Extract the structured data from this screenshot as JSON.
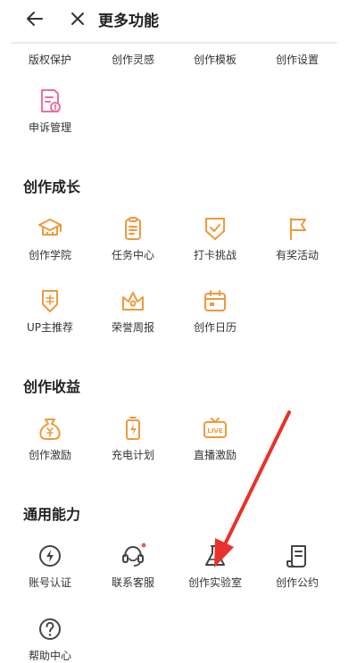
{
  "header": {
    "title": "更多功能"
  },
  "top_row": [
    "版权保护",
    "创作灵感",
    "创作模板",
    "创作设置"
  ],
  "top_extra": {
    "label": "申诉管理"
  },
  "sections": [
    {
      "title": "创作成长",
      "items": [
        "创作学院",
        "任务中心",
        "打卡挑战",
        "有奖活动",
        "UP主推荐",
        "荣誉周报",
        "创作日历"
      ]
    },
    {
      "title": "创作收益",
      "items": [
        "创作激励",
        "充电计划",
        "直播激励"
      ]
    },
    {
      "title": "通用能力",
      "items": [
        "账号认证",
        "联系客服",
        "创作实验室",
        "创作公约",
        "帮助中心"
      ]
    }
  ],
  "icons": {
    "appeal": "document-alert-icon",
    "academy": "graduation-cap-icon",
    "tasks": "clipboard-icon",
    "checkin": "shield-check-icon",
    "awards": "flag-icon",
    "up_recommend": "badge-icon",
    "honor": "crown-icon",
    "calendar": "calendar-icon",
    "incentive": "money-bag-icon",
    "charge": "battery-bolt-icon",
    "live": "tv-icon",
    "verify": "lightning-circle-icon",
    "support": "headset-icon",
    "lab": "flask-icon",
    "convention": "scroll-icon",
    "help": "question-circle-icon"
  },
  "colors": {
    "orange": "#ee9a3c",
    "pink": "#ee6f9a",
    "gray": "#444444",
    "red_dot": "#f25d58",
    "arrow": "#e8322b"
  },
  "badges": {
    "support_dot": true
  }
}
